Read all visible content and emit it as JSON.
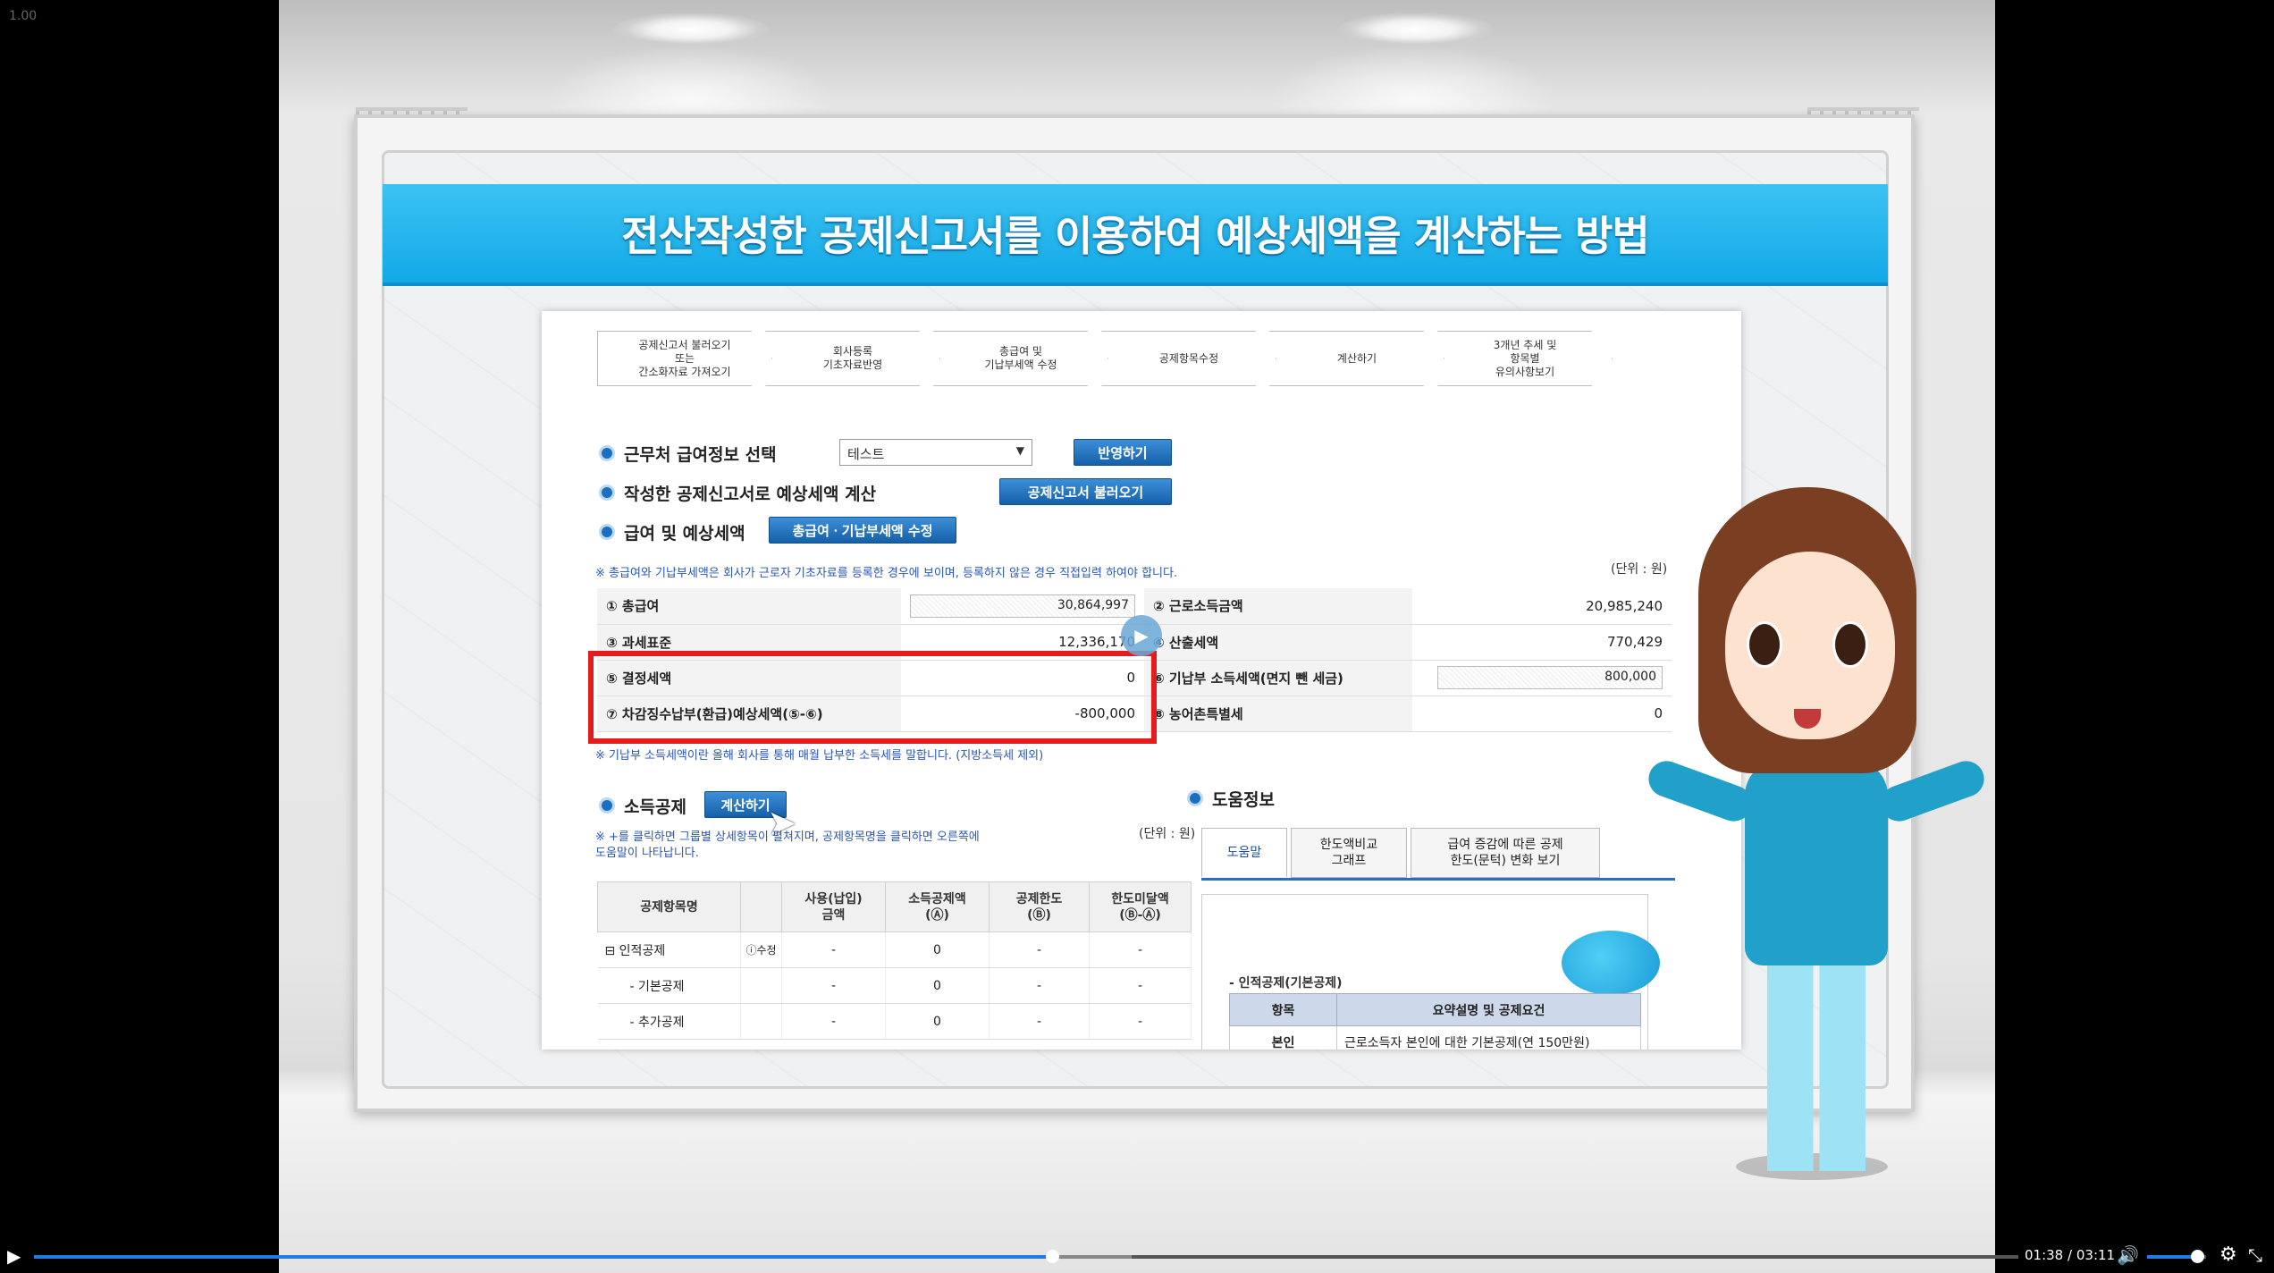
{
  "player": {
    "speed": "1.00",
    "current_time": "01:38",
    "duration": "03:11",
    "time_separator": "/",
    "progress": 0.513,
    "buffered": 0.553,
    "volume": 0.85
  },
  "slide": {
    "title": "전산작성한 공제신고서를 이용하여 예상세액을 계산하는 방법"
  },
  "steps": [
    "공제신고서 불러오기\n또는\n간소화자료 가져오기",
    "회사등록\n기초자료반영",
    "총급여 및\n기납부세액 수정",
    "공제항목수정",
    "계산하기",
    "3개년 추세 및\n항목별\n유의사항보기"
  ],
  "section1": {
    "title": "근무처 급여정보 선택",
    "select_value": "테스트",
    "apply_btn": "반영하기"
  },
  "section2": {
    "title": "작성한 공제신고서로 예상세액 계산",
    "load_btn": "공제신고서 불러오기"
  },
  "section3": {
    "title": "급여 및 예상세액",
    "edit_btn": "총급여ㆍ기납부세액 수정",
    "note": "※ 총급여와 기납부세액은 회사가 근로자 기초자료를 등록한 경우에 보이며, 등록하지 않은 경우 직접입력 하여야 합니다.",
    "unit": "(단위 : 원)",
    "rows": [
      {
        "l1": "① 총급여",
        "v1": "30,864,997",
        "l2": "② 근로소득금액",
        "v2": "20,985,240"
      },
      {
        "l1": "③ 과세표준",
        "v1": "12,336,170",
        "l2": "④ 산출세액",
        "v2": "770,429"
      },
      {
        "l1": "⑤ 결정세액",
        "v1": "0",
        "l2": "⑥ 기납부 소득세액(면지 뺀 세금)",
        "v2": "800,000"
      },
      {
        "l1": "⑦ 차감징수납부(환급)예상세액(⑤-⑥)",
        "v1": "-800,000",
        "l2": "⑧ 농어촌특별세",
        "v2": "0"
      }
    ],
    "footnote": "※ 기납부 소득세액이란 올해 회사를 통해 매월 납부한 소득세를 말합니다. (지방소득세 제외)"
  },
  "section4": {
    "title": "소득공제",
    "calc_btn": "계산하기",
    "note": "※ +를 클릭하면 그룹별 상세항목이 펼쳐지며, 공제항목명을 클릭하면 오른쪽에\n도움말이 나타납니다.",
    "unit": "(단위 : 원)",
    "headers": [
      "공제항목명",
      "사용(납입)\n금액",
      "소득공제액\n(Ⓐ)",
      "공제한도\n(Ⓑ)",
      "한도미달액\n(Ⓑ-Ⓐ)"
    ],
    "rows": [
      {
        "name": "⊟ 인적공제",
        "extra": "ⓘ수정",
        "c1": "-",
        "c2": "0",
        "c3": "-",
        "c4": "-"
      },
      {
        "name": "- 기본공제",
        "extra": "",
        "c1": "-",
        "c2": "0",
        "c3": "-",
        "c4": "-"
      },
      {
        "name": "- 추가공제",
        "extra": "",
        "c1": "-",
        "c2": "0",
        "c3": "-",
        "c4": "-"
      }
    ]
  },
  "help": {
    "title": "도움정보",
    "tabs": [
      "도움말",
      "한도액비교\n그래프",
      "급여 증감에 따른 공제\n한도(문턱) 변화 보기"
    ],
    "section_title": "- 인적공제(기본공제)",
    "headers": [
      "항목",
      "요약설명 및 공제요건"
    ],
    "rows": [
      {
        "k": "본인",
        "v": "근로소득자 본인에 대한 기본공제(연 150만원)"
      }
    ]
  },
  "colors": {
    "accent": "#1e7be0",
    "banner": "#1aaeea",
    "highlight": "#e41c1c",
    "button": "#1a6fc1"
  }
}
